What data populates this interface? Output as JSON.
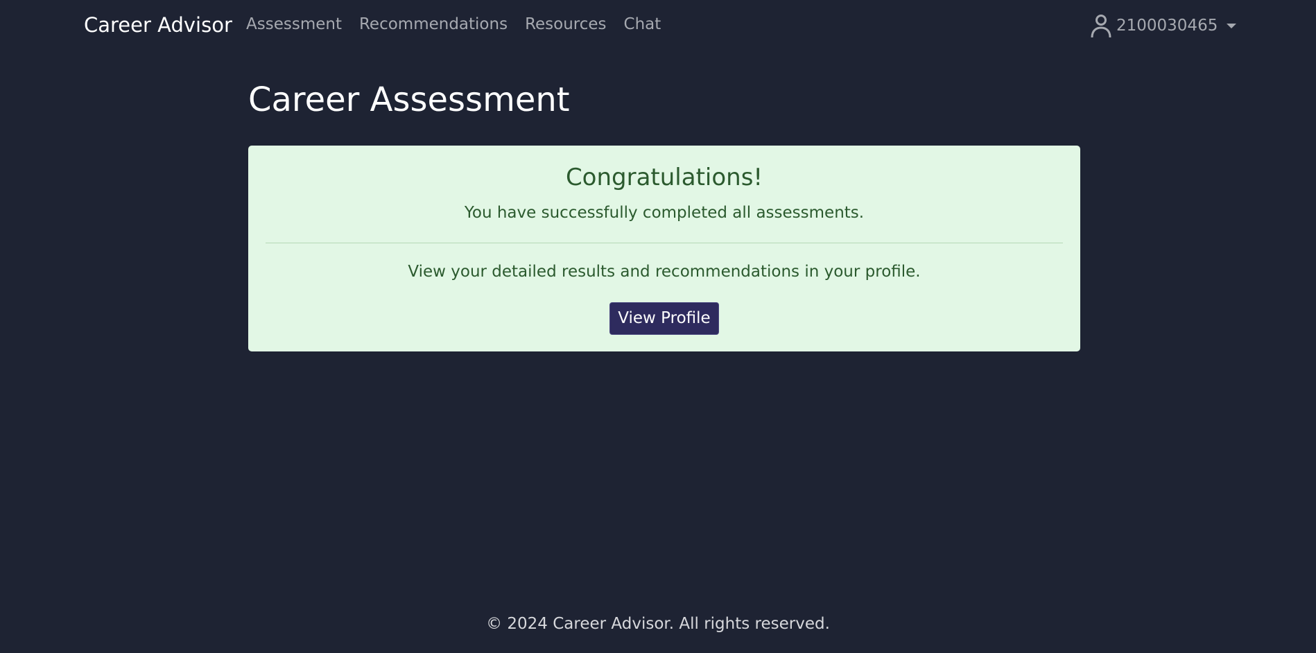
{
  "nav": {
    "brand": "Career Advisor",
    "links": [
      {
        "label": "Assessment"
      },
      {
        "label": "Recommendations"
      },
      {
        "label": "Resources"
      },
      {
        "label": "Chat"
      }
    ],
    "user": {
      "id": "2100030465",
      "icon": "user-icon"
    }
  },
  "main": {
    "title": "Career Assessment",
    "alert": {
      "heading": "Congratulations!",
      "text": "You have successfully completed all assessments.",
      "subtext": "View your detailed results and recommendations in your profile.",
      "button_label": "View Profile"
    }
  },
  "footer": {
    "text": "© 2024 Career Advisor. All rights reserved."
  },
  "colors": {
    "background": "#1e2333",
    "alert_background": "#e2f7e5",
    "alert_text": "#2b5a2e",
    "button": "#2e2b5e",
    "nav_link": "#a6a9b0"
  }
}
